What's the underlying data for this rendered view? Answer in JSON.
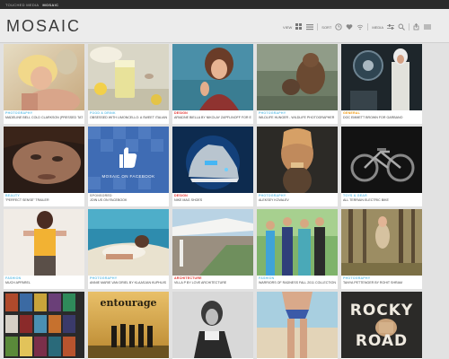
{
  "topbar": {
    "prefix": "TOUCHED MEDIA",
    "accent": "MOSAIC"
  },
  "header": {
    "logo": "MOSAIC",
    "toolbar": {
      "view_label": "VIEW",
      "sort_label": "SORT",
      "media_label": "MEDIA"
    }
  },
  "colors": {
    "photography": "#6dc3e8",
    "design": "#e2322f",
    "general": "#f29a12",
    "sponsored": "#888888",
    "toolbar_icon": "#888888"
  },
  "tiles": [
    {
      "category": "PHOTOGRAPHY",
      "title": "MADELINE BELL COLD CLARKSON (PRESSED TAT)",
      "cat_color": "photography",
      "image": "blonde-portrait"
    },
    {
      "category": "FOOD & DRINK",
      "title": "OBSESSED WITH LIMONCELLO: A SWEET ITALIAN LIQUEUR",
      "cat_color": "photography",
      "image": "lemon-drink"
    },
    {
      "category": "DESIGN",
      "title": "ARIADNE BIELLA BY NIKOLAY ZAPFLINOFF FOR ELLE",
      "cat_color": "design",
      "image": "woman-portrait"
    },
    {
      "category": "PHOTOGRAPHY",
      "title": "WILDLIFE HUNGER - WILDLIFE PHOTOGRAPHER",
      "cat_color": "photography",
      "image": "bear"
    },
    {
      "category": "GENERAL",
      "title": "DOC EMMETT BROWN FOR GARBANO",
      "cat_color": "general",
      "image": "doc-brown"
    },
    {
      "category": "BEAUTY",
      "title": "\"PERFECT SENSE\" TRAILER",
      "cat_color": "photography",
      "image": "face-closeup"
    },
    {
      "category": "SPONSORED",
      "title": "JOIN US ON FACEBOOK",
      "cat_color": "sponsored",
      "image": "facebook",
      "overlay": "MOSAIC ON FACEBOOK"
    },
    {
      "category": "DESIGN",
      "title": "NIKE MAG SHOES",
      "cat_color": "design",
      "image": "sneaker"
    },
    {
      "category": "PHOTOGRAPHY",
      "title": "ALEKSEY KOVALEV",
      "cat_color": "photography",
      "image": "mystic-face"
    },
    {
      "category": "TOYS & GEAR",
      "title": "ALL TERRAIN ELECTRIC BIKE",
      "cat_color": "photography",
      "image": "bike"
    },
    {
      "category": "FASHION",
      "title": "MUCH APPAREL",
      "cat_color": "photography",
      "image": "fashion"
    },
    {
      "category": "PHOTOGRAPHY",
      "title": "ANNIE MARIE VAN DRIEL BY KLAASJAN KUPHUIS",
      "cat_color": "photography",
      "image": "sandy-beach"
    },
    {
      "category": "ARCHITECTURE",
      "title": "VILLA P BY LOVE ARCHITECTURE",
      "cat_color": "design",
      "image": "house"
    },
    {
      "category": "FASHION",
      "title": "WARRIORS OF RADNESS FALL 2011 COLLECTION",
      "cat_color": "photography",
      "image": "group"
    },
    {
      "category": "PHOTOGRAPHY",
      "title": "TANYA PETTENGER BY ROHIT SHRAM",
      "cat_color": "photography",
      "image": "forest"
    },
    {
      "category": "",
      "title": "",
      "cat_color": "photography",
      "image": "book-spines"
    },
    {
      "category": "",
      "title": "",
      "cat_color": "photography",
      "image": "entourage",
      "overlay": "entourage"
    },
    {
      "category": "",
      "title": "",
      "cat_color": "photography",
      "image": "bw-portrait"
    },
    {
      "category": "",
      "title": "",
      "cat_color": "photography",
      "image": "beach-legs"
    },
    {
      "category": "",
      "title": "",
      "cat_color": "photography",
      "image": "rocky-road",
      "overlay": "ROCKY ROAD"
    }
  ]
}
